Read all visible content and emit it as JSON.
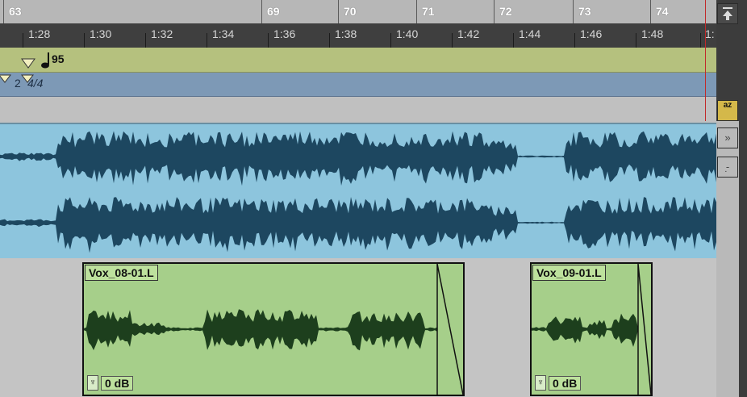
{
  "rulers": {
    "bars": [
      "63",
      "69",
      "70",
      "71",
      "72",
      "73",
      "74"
    ],
    "timecode": [
      "1:28",
      "1:30",
      "1:32",
      "1:34",
      "1:36",
      "1:38",
      "1:40",
      "1:42",
      "1:44",
      "1:46",
      "1:48",
      "1:"
    ],
    "tempo": "95",
    "meter": {
      "marker_number": "2",
      "signature": "4/4"
    }
  },
  "clips": [
    {
      "name": "Vox_08-01.L",
      "gain": "0 dB"
    },
    {
      "name": "Vox_09-01.L",
      "gain": "0 dB"
    }
  ],
  "side_controls": {
    "scroll_to_top_icon": "arrow-up-to-line-icon",
    "az_icon": "sort-az-icon",
    "az_label": "az"
  },
  "colors": {
    "audio_track_bg": "#8dc5dd",
    "audio_waveform": "#1d4760",
    "clip_bg": "#a6cf8a",
    "clip_waveform": "#1d3f1d",
    "tempo_ruler": "#b5c17e",
    "meter_ruler": "#7d99b6",
    "playhead": "#c12a2a"
  }
}
